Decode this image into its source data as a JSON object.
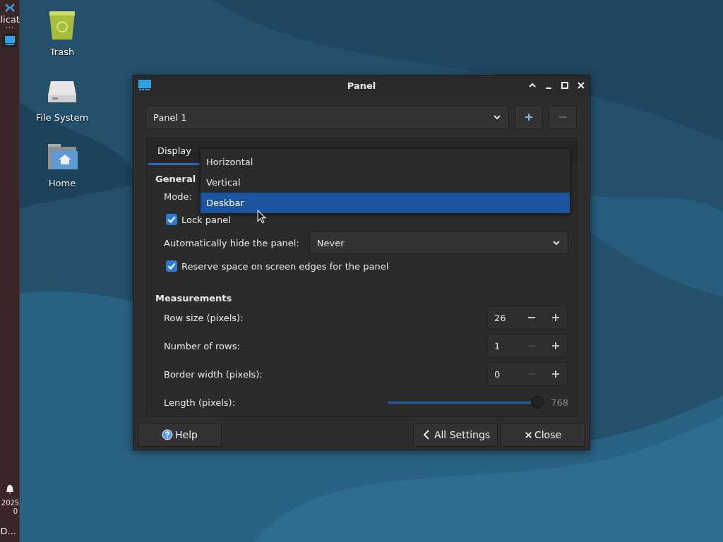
{
  "side_panel": {
    "texts": [
      "licat",
      "2025",
      "0",
      "D..."
    ]
  },
  "desktop_icons": [
    {
      "label": "Trash",
      "kind": "trash"
    },
    {
      "label": "File System",
      "kind": "drive"
    },
    {
      "label": "Home",
      "kind": "home"
    }
  ],
  "window": {
    "title": "Panel"
  },
  "panel_selector": {
    "value": "Panel 1"
  },
  "tabs": [
    {
      "label": "Display",
      "selected": true
    }
  ],
  "general": {
    "heading": "General",
    "mode_label": "Mode:",
    "lock": {
      "label": "Lock panel",
      "checked": true
    },
    "autohide": {
      "label": "Automatically hide the panel:",
      "value": "Never"
    },
    "reserve": {
      "label": "Reserve space on screen edges for the panel",
      "checked": true
    }
  },
  "measurements": {
    "heading": "Measurements",
    "spinners": [
      {
        "label": "Row size (pixels):",
        "value": "26",
        "minus_disabled": false
      },
      {
        "label": "Number of rows:",
        "value": "1",
        "minus_disabled": true
      },
      {
        "label": "Border width (pixels):",
        "value": "0",
        "minus_disabled": true
      }
    ],
    "length": {
      "label": "Length (pixels):",
      "level": 1,
      "reading": "768"
    }
  },
  "buttons": [
    {
      "label": "Help",
      "kind": "help"
    },
    {
      "label": "All Settings",
      "kind": "back"
    },
    {
      "label": "Close",
      "kind": "close"
    }
  ],
  "mode_popup": [
    {
      "label": "Horizontal",
      "selected": false
    },
    {
      "label": "Vertical",
      "selected": false
    },
    {
      "label": "Deskbar",
      "selected": true
    }
  ]
}
